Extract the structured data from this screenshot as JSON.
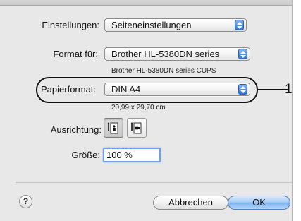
{
  "settings": {
    "label": "Einstellungen:",
    "value": "Seiteneinstellungen"
  },
  "format_for": {
    "label": "Format für:",
    "value": "Brother HL-5380DN series",
    "subtext": "Brother HL-5380DN series CUPS"
  },
  "paper_format": {
    "label": "Papierformat:",
    "value": "DIN A4",
    "dimensions": "20,99 x 29,70 cm"
  },
  "callout": {
    "number": "1"
  },
  "orientation": {
    "label": "Ausrichtung:",
    "options": [
      {
        "icon": "portrait-orientation-icon",
        "selected": true
      },
      {
        "icon": "landscape-orientation-icon",
        "selected": false
      }
    ]
  },
  "scale": {
    "label": "Größe:",
    "value": "100 %"
  },
  "buttons": {
    "help": "?",
    "cancel": "Abbrechen",
    "ok": "OK"
  },
  "colors": {
    "accent": "#2f74d6",
    "default_button": "#7fb4ef",
    "dialog_bg": "#e8e8e8"
  }
}
